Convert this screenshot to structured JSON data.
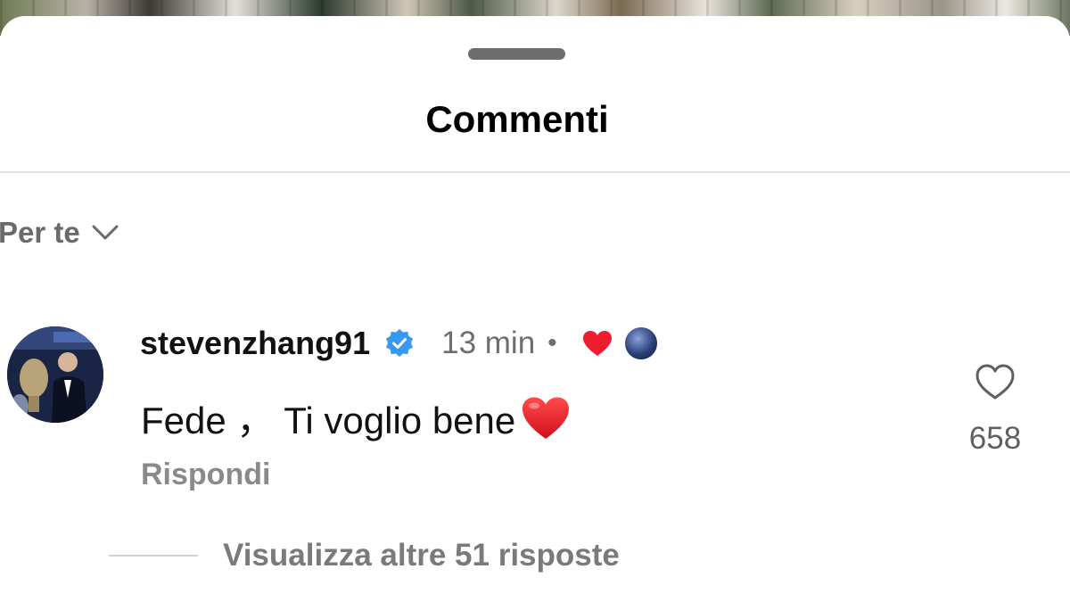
{
  "header": {
    "title": "Commenti"
  },
  "sort": {
    "label": "Per te"
  },
  "comment": {
    "username": "stevenzhang91",
    "verified": true,
    "timestamp": "13 min",
    "separator": "•",
    "text": "Fede ， Ti voglio bene",
    "emoji": "red-heart",
    "reply_label": "Rispondi",
    "like_count": "658",
    "liked_by_author": true,
    "view_replies_label": "Visualizza altre 51 risposte"
  },
  "colors": {
    "verified_blue": "#3897f0",
    "heart_red": "#ed1c2e",
    "text_primary": "#111111",
    "text_secondary": "#6e6e6e"
  },
  "icons": {
    "sort": "chevron-down-icon",
    "verified": "verified-badge-icon",
    "author_like": "heart-filled-icon",
    "like": "heart-outline-icon"
  }
}
